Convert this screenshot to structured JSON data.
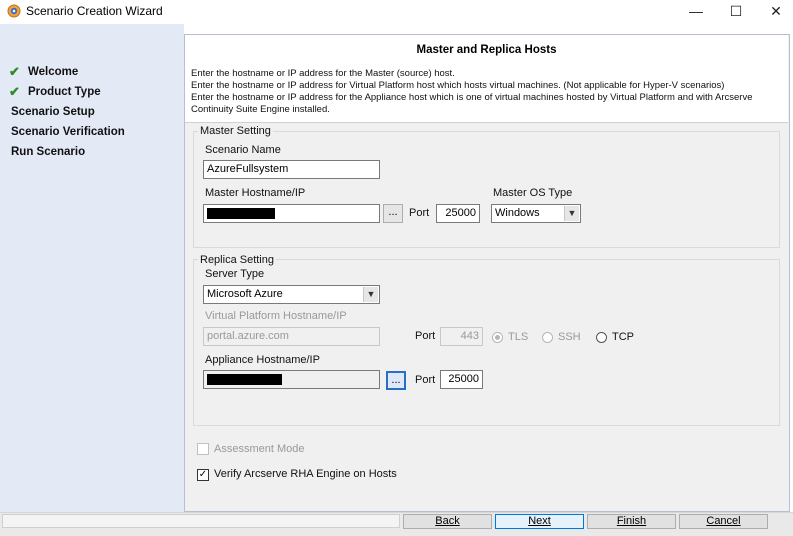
{
  "window": {
    "title": "Scenario Creation Wizard",
    "minimize_glyph": "—",
    "maximize_glyph": "☐",
    "close_glyph": "✕",
    "icon": "arcserve-app-icon"
  },
  "sidebar": {
    "items": [
      {
        "label": "Welcome",
        "completed": true
      },
      {
        "label": "Product Type",
        "completed": true
      },
      {
        "label": "Scenario Setup",
        "completed": false
      },
      {
        "label": "Scenario Verification",
        "completed": false
      },
      {
        "label": "Run Scenario",
        "completed": false
      }
    ],
    "check_glyph": "✔"
  },
  "header": {
    "title": "Master and Replica Hosts",
    "lines": [
      "Enter the hostname or IP address for the Master (source) host.",
      "Enter the hostname or IP address for Virtual Platform host which hosts virtual machines. (Not applicable for Hyper-V scenarios)",
      "Enter the hostname or IP address for the Appliance host which is one of virtual machines hosted by Virtual Platform and with Arcserve",
      "Continuity Suite Engine installed."
    ]
  },
  "master": {
    "group_label": "Master Setting",
    "scenario_name_label": "Scenario Name",
    "scenario_name_value": "AzureFullsystem",
    "hostname_label": "Master Hostname/IP",
    "browse_label": "...",
    "port_label": "Port",
    "port_value": "25000",
    "os_type_label": "Master OS Type",
    "os_type_value": "Windows"
  },
  "replica": {
    "group_label": "Replica Setting",
    "server_type_label": "Server Type",
    "server_type_value": "Microsoft Azure",
    "vp_hostname_label": "Virtual Platform Hostname/IP",
    "vp_hostname_value": "portal.azure.com",
    "vp_port_label": "Port",
    "vp_port_value": "443",
    "protocols": [
      {
        "label": "TLS",
        "checked": true,
        "enabled": false
      },
      {
        "label": "SSH",
        "checked": false,
        "enabled": false
      },
      {
        "label": "TCP",
        "checked": false,
        "enabled": true
      }
    ],
    "appliance_hostname_label": "Appliance Hostname/IP",
    "browse_label": "...",
    "appliance_port_label": "Port",
    "appliance_port_value": "25000"
  },
  "options": {
    "assessment_mode_label": "Assessment Mode",
    "assessment_mode_checked": false,
    "verify_engine_label": "Verify Arcserve RHA Engine on Hosts",
    "verify_engine_checked": true,
    "check_glyph": "✓"
  },
  "footer": {
    "back_label": "Back",
    "next_label": "Next",
    "finish_label": "Finish",
    "cancel_label": "Cancel"
  }
}
